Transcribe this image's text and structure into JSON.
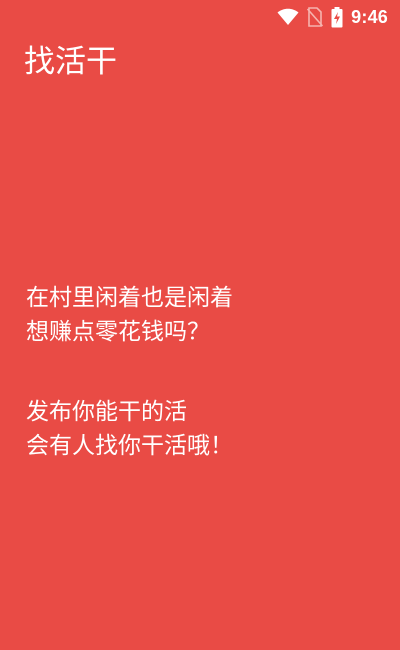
{
  "status_bar": {
    "time": "9:46",
    "icons": [
      "wifi-icon",
      "no-sim-icon",
      "battery-charging-icon"
    ]
  },
  "app": {
    "title": "找活干"
  },
  "message": {
    "paragraph_1": [
      "在村里闲着也是闲着",
      "想赚点零花钱吗？"
    ],
    "paragraph_2": [
      "发布你能干的活",
      "会有人找你干活哦！"
    ]
  },
  "colors": {
    "background": "#E94B45",
    "text": "#FFFFFF"
  }
}
